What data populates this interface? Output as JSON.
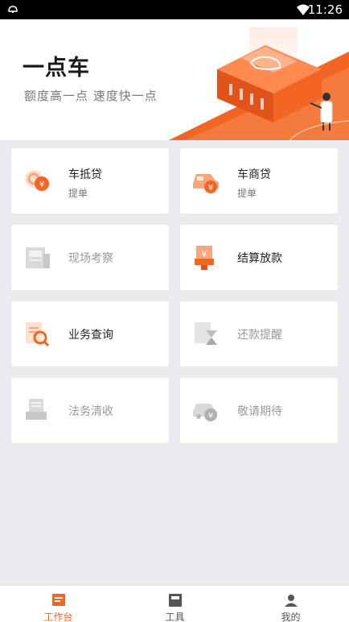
{
  "status_bar": {
    "time": "11:26"
  },
  "hero": {
    "title": "一点车",
    "subtitle": "额度高一点  速度快一点"
  },
  "cards": [
    {
      "label": "车抵贷",
      "sub": "提单",
      "enabled": true,
      "icon": "car-loan-icon"
    },
    {
      "label": "车商贷",
      "sub": "提单",
      "enabled": true,
      "icon": "dealer-loan-icon"
    },
    {
      "label": "现场考察",
      "sub": "",
      "enabled": false,
      "icon": "onsite-inspection-icon"
    },
    {
      "label": "结算放款",
      "sub": "",
      "enabled": true,
      "icon": "settlement-icon"
    },
    {
      "label": "业务查询",
      "sub": "",
      "enabled": true,
      "icon": "business-query-icon"
    },
    {
      "label": "还款提醒",
      "sub": "",
      "enabled": false,
      "icon": "repayment-reminder-icon"
    },
    {
      "label": "法务清收",
      "sub": "",
      "enabled": false,
      "icon": "legal-collection-icon"
    },
    {
      "label": "敬请期待",
      "sub": "",
      "enabled": false,
      "icon": "coming-soon-icon"
    }
  ],
  "tabs": [
    {
      "label": "工作台",
      "active": true,
      "icon": "workbench-icon"
    },
    {
      "label": "工具",
      "active": false,
      "icon": "tools-icon"
    },
    {
      "label": "我的",
      "active": false,
      "icon": "profile-icon"
    }
  ],
  "colors": {
    "accent": "#f26522",
    "background": "#ebebef",
    "disabled": "#bfbfbf"
  }
}
